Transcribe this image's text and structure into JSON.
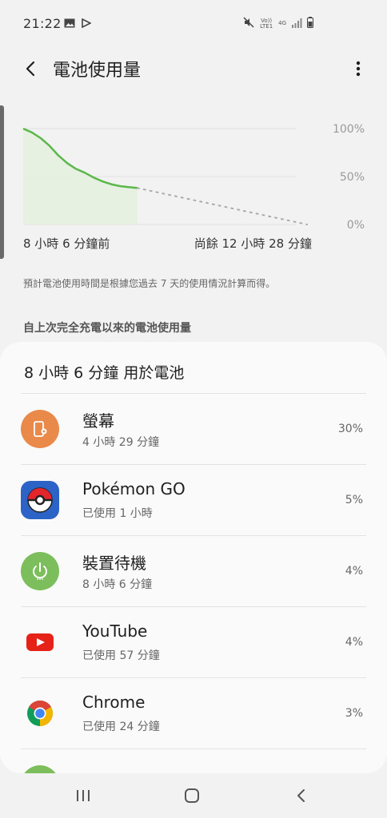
{
  "status_bar": {
    "time": "21:22",
    "volte_label": "Vo)) LTE1",
    "network_label": "4G"
  },
  "header": {
    "title": "電池使用量"
  },
  "chart_data": {
    "type": "line",
    "y_ticks": [
      "100%",
      "50%",
      "0%"
    ],
    "ylim": [
      0,
      100
    ],
    "series": [
      {
        "values": [
          100,
          96,
          90,
          82,
          72,
          64,
          58,
          54,
          49,
          45,
          42,
          40,
          39,
          38
        ]
      }
    ],
    "projection": {
      "from": 38,
      "to": 0
    },
    "start_label": "8 小時 6 分鐘前",
    "end_label": "尚餘 12 小時 28 分鐘",
    "colors": {
      "line": "#5cb84a",
      "fill": "#e4f1df",
      "projection": "#aaaaaa"
    }
  },
  "info_text": "預計電池使用時間是根據您過去 7 天的使用情況計算而得。",
  "section_title": "自上次完全充電以來的電池使用量",
  "card": {
    "title": "8 小時 6 分鐘 用於電池",
    "apps": [
      {
        "name": "螢幕",
        "sub": "4 小時 29 分鐘",
        "pct": "30%",
        "icon": "screen-icon",
        "color": "#e98a4a"
      },
      {
        "name": "Pokémon GO",
        "sub": "已使用 1 小時",
        "pct": "5%",
        "icon": "pokeball-icon",
        "color": "#2b63c6"
      },
      {
        "name": "裝置待機",
        "sub": "8 小時 6 分鐘",
        "pct": "4%",
        "icon": "power-icon",
        "color": "#7cbd5c"
      },
      {
        "name": "YouTube",
        "sub": "已使用 57 分鐘",
        "pct": "4%",
        "icon": "youtube-icon",
        "color": "#e62117"
      },
      {
        "name": "Chrome",
        "sub": "已使用 24 分鐘",
        "pct": "3%",
        "icon": "chrome-icon",
        "color": "#4a8af4"
      },
      {
        "name": "",
        "sub": "",
        "pct": "",
        "icon": "call-icon",
        "color": "#7cbd5c"
      }
    ]
  },
  "nav": {
    "recents_icon": "recents-icon",
    "home_icon": "home-icon",
    "back_icon": "back-icon"
  }
}
